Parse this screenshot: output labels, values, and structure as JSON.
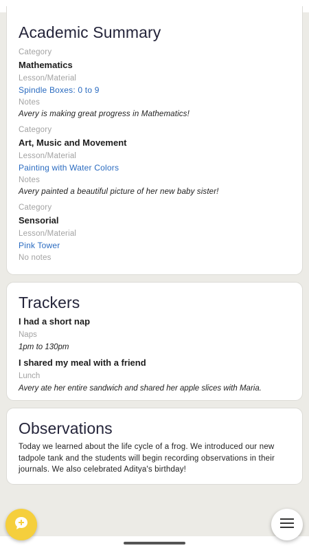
{
  "academic_summary": {
    "title": "Academic Summary",
    "entries": [
      {
        "category_label": "Category",
        "category": "Mathematics",
        "lesson_label": "Lesson/Material",
        "lesson": "Spindle Boxes: 0 to 9",
        "notes_label": "Notes",
        "notes": "Avery is making great progress in Mathematics!"
      },
      {
        "category_label": "Category",
        "category": "Art, Music and Movement",
        "lesson_label": "Lesson/Material",
        "lesson": "Painting with Water Colors",
        "notes_label": "Notes",
        "notes": "Avery painted a beautiful picture of her new baby sister!"
      },
      {
        "category_label": "Category",
        "category": "Sensorial",
        "lesson_label": "Lesson/Material",
        "lesson": "Pink Tower",
        "no_notes": "No notes"
      }
    ]
  },
  "trackers": {
    "title": "Trackers",
    "items": [
      {
        "title": "I had a short nap",
        "type": "Naps",
        "note": "1pm to 130pm"
      },
      {
        "title": "I shared my meal with a friend",
        "type": "Lunch",
        "note": "Avery ate her entire sandwich and shared her apple slices with Maria."
      }
    ]
  },
  "observations": {
    "title": "Observations",
    "text": "Today we learned about the life cycle of a frog. We introduced our new tadpole tank and the students will begin recording observations in their journals. We also celebrated Aditya's birthday!"
  },
  "fab": {
    "add_icon": "chat-add-icon",
    "menu_icon": "menu-icon"
  },
  "colors": {
    "background": "#ecebe6",
    "card": "#ffffff",
    "link": "#2a6bc0",
    "fab_accent": "#f5cf3d",
    "title": "#24243a"
  }
}
